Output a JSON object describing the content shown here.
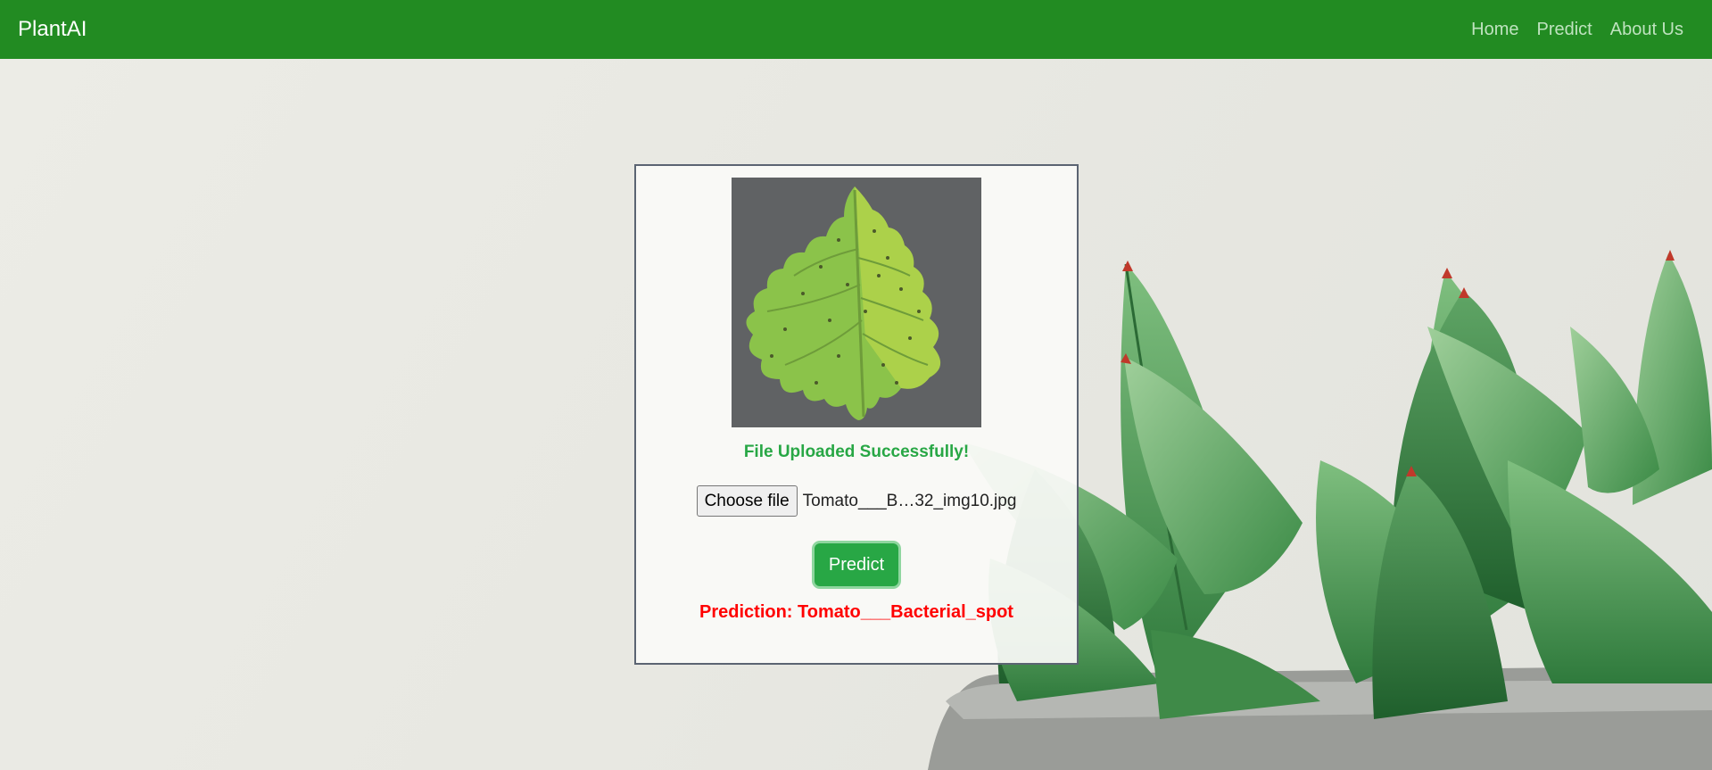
{
  "colors": {
    "navbar": "#228b22",
    "status_text": "#28a745",
    "prediction_text": "#ff0000",
    "button": "#28a745"
  },
  "navbar": {
    "brand": "PlantAI",
    "links": [
      {
        "label": "Home"
      },
      {
        "label": "Predict"
      },
      {
        "label": "About Us"
      }
    ]
  },
  "card": {
    "image_icon": "leaf-image",
    "status": "File Uploaded Successfully!",
    "file_input": {
      "button_label": "Choose file",
      "file_name": "Tomato___B…32_img10.jpg"
    },
    "predict_label": "Predict",
    "prediction": "Prediction: Tomato___Bacterial_spot"
  }
}
